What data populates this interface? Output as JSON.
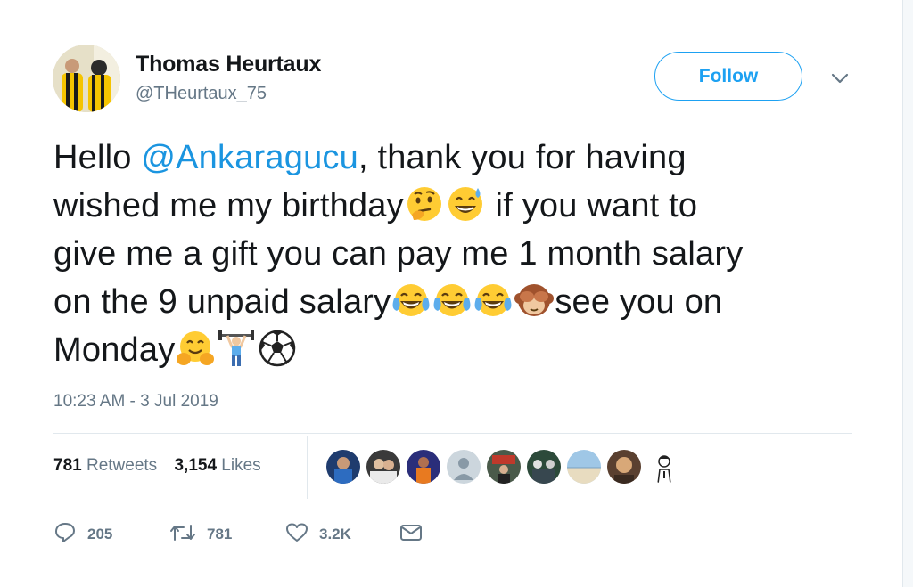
{
  "author": {
    "name": "Thomas Heurtaux",
    "handle": "@THeurtaux_75"
  },
  "follow_label": "Follow",
  "tweet": {
    "lines": [
      {
        "pre": "Hello ",
        "mention": "@Ankaragucu",
        "post": ", thank you for having"
      },
      {
        "pre": "wished me my birthday",
        "post": "  if you want to"
      },
      {
        "pre": "give me a gift you can pay me 1 month salary"
      },
      {
        "pre": "on the 9 unpaid salary",
        "post": "see you on"
      },
      {
        "pre": "Monday"
      }
    ],
    "emoji": [
      "thinking-face",
      "grinning-sweat-face",
      "tears-of-joy-face",
      "tears-of-joy-face",
      "tears-of-joy-face",
      "see-no-evil-monkey",
      "hugging-face",
      "weightlifter",
      "soccer-ball"
    ]
  },
  "timestamp": "10:23 AM - 3 Jul 2019",
  "stats": {
    "retweets_count": "781",
    "retweets_label": "Retweets",
    "likes_count": "3,154",
    "likes_label": "Likes"
  },
  "likers": [
    "liker-avatar",
    "liker-avatar",
    "liker-avatar",
    "liker-avatar",
    "liker-avatar",
    "liker-avatar",
    "liker-avatar",
    "liker-avatar",
    "liker-avatar"
  ],
  "actions": {
    "reply_count": "205",
    "retweet_count": "781",
    "like_count": "3.2K"
  },
  "colors": {
    "accent": "#1da1f2",
    "mention": "#1b95e0",
    "text": "#14171a",
    "muted": "#657786",
    "divider": "#e1e8ed"
  }
}
